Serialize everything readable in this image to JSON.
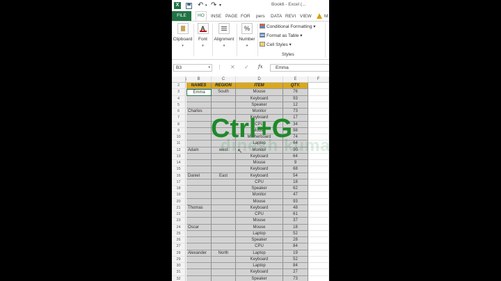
{
  "window": {
    "title": "Book6 - Excel (..."
  },
  "quick_access": {
    "app_icon": "X",
    "save_icon": "save-icon",
    "undo_icon": "↶",
    "redo_icon": "↷",
    "dropdown": "▾"
  },
  "tabs": [
    {
      "label": "FILE"
    },
    {
      "label": "HO"
    },
    {
      "label": "INSE"
    },
    {
      "label": "PAGE"
    },
    {
      "label": "FOR"
    },
    {
      "label": "pers"
    },
    {
      "label": "DATA"
    },
    {
      "label": "REVI"
    },
    {
      "label": "VIEW"
    },
    {
      "label": "M"
    }
  ],
  "ribbon": {
    "clipboard": "Clipboard",
    "font": "Font",
    "font_icon": "A",
    "alignment": "Alignment",
    "number": "Number",
    "number_icon": "%",
    "dropdown_arrow": "▾",
    "conditional_formatting": "Conditional Formatting",
    "format_as_table": "Format as Table",
    "cell_styles": "Cell Styles",
    "styles_group": "Styles"
  },
  "formula_bar": {
    "name_box": "B3",
    "fx": "fx",
    "cancel": "✕",
    "enter": "✓",
    "dots": "⋮",
    "value": "Emma"
  },
  "columns": [
    "A",
    "B",
    "C",
    "D",
    "E",
    "F"
  ],
  "rows": [
    "2",
    "3",
    "4",
    "5",
    "6",
    "7",
    "8",
    "9",
    "10",
    "11",
    "12",
    "13",
    "14",
    "15",
    "16",
    "17",
    "18",
    "19",
    "20",
    "21",
    "22",
    "23",
    "24",
    "25",
    "26",
    "27",
    "28",
    "29",
    "30",
    "31",
    "32"
  ],
  "table": {
    "headers": [
      "NAMES",
      "REGION",
      "ITEM",
      "QTY."
    ],
    "data": [
      [
        "Emma",
        "South",
        "Mouse",
        "76"
      ],
      [
        "",
        "",
        "Keyboard",
        "93"
      ],
      [
        "",
        "",
        "Speaker",
        "12"
      ],
      [
        "Charles",
        "",
        "Monitor",
        "73"
      ],
      [
        "",
        "",
        "Keyboard",
        "17"
      ],
      [
        "",
        "",
        "CPU",
        "34"
      ],
      [
        "",
        "",
        "Mouse",
        "98"
      ],
      [
        "",
        "",
        "Motherboard",
        "74"
      ],
      [
        "",
        "",
        "Laptop",
        "64"
      ],
      [
        "Adam",
        "west",
        "Monitor",
        "90"
      ],
      [
        "",
        "",
        "Keyboard",
        "64"
      ],
      [
        "",
        "",
        "Mouse",
        "9"
      ],
      [
        "",
        "",
        "Keyboard",
        "68"
      ],
      [
        "Daniel",
        "East",
        "Keyboard",
        "54"
      ],
      [
        "",
        "",
        "CPU",
        "18"
      ],
      [
        "",
        "",
        "Speaker",
        "62"
      ],
      [
        "",
        "",
        "Monitor",
        "47"
      ],
      [
        "",
        "",
        "Mouse",
        "93"
      ],
      [
        "Thomas",
        "",
        "Keyboard",
        "48"
      ],
      [
        "",
        "",
        "CPU",
        "61"
      ],
      [
        "",
        "",
        "Mouse",
        "37"
      ],
      [
        "Oscar",
        "",
        "Mouse",
        "18"
      ],
      [
        "",
        "",
        "Laptop",
        "52"
      ],
      [
        "",
        "",
        "Speaker",
        "28"
      ],
      [
        "",
        "",
        "CPU",
        "84"
      ],
      [
        "Alexander",
        "North",
        "Laptop",
        "19"
      ],
      [
        "",
        "",
        "Keyboard",
        "52"
      ],
      [
        "",
        "",
        "Laptop",
        "84"
      ],
      [
        "",
        "",
        "Keyboard",
        "27"
      ],
      [
        "",
        "",
        "Speaker",
        "73"
      ]
    ]
  },
  "overlay_text": "Ctrl+G",
  "watermark": "dinesh kumar",
  "colors": {
    "excel_green": "#217346",
    "header_gold": "#d9a81f",
    "selection_gray": "#d3d3d3",
    "overlay_green": "#1f8a2a"
  }
}
